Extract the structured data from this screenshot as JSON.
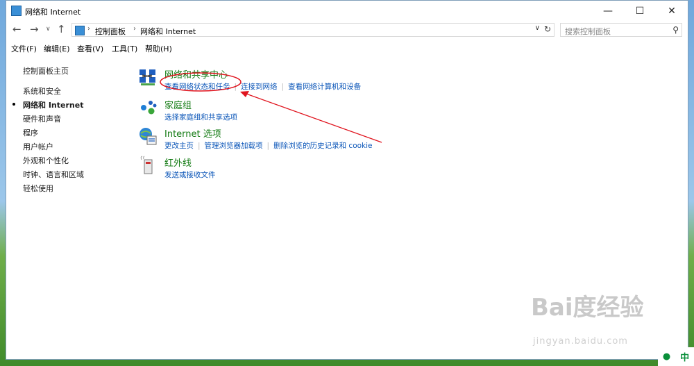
{
  "window": {
    "title": "网络和 Internet"
  },
  "address": {
    "breadcrumbs": [
      "控制面板",
      "网络和 Internet"
    ],
    "search_placeholder": "搜索控制面板"
  },
  "menu": [
    "文件(F)",
    "编辑(E)",
    "查看(V)",
    "工具(T)",
    "帮助(H)"
  ],
  "sidebar": {
    "items": [
      {
        "label": "控制面板主页",
        "active": false
      },
      {
        "label": "系统和安全",
        "active": false
      },
      {
        "label": "网络和 Internet",
        "active": true
      },
      {
        "label": "硬件和声音",
        "active": false
      },
      {
        "label": "程序",
        "active": false
      },
      {
        "label": "用户帐户",
        "active": false
      },
      {
        "label": "外观和个性化",
        "active": false
      },
      {
        "label": "时钟、语言和区域",
        "active": false
      },
      {
        "label": "轻松使用",
        "active": false
      }
    ]
  },
  "categories": [
    {
      "icon": "network-sharing-center-icon",
      "title": "网络和共享中心",
      "links": [
        "查看网络状态和任务",
        "连接到网络",
        "查看网络计算机和设备"
      ]
    },
    {
      "icon": "homegroup-icon",
      "title": "家庭组",
      "links": [
        "选择家庭组和共享选项"
      ]
    },
    {
      "icon": "internet-options-icon",
      "title": "Internet 选项",
      "links": [
        "更改主页",
        "管理浏览器加载项",
        "删除浏览的历史记录和 cookie"
      ]
    },
    {
      "icon": "infrared-icon",
      "title": "红外线",
      "links": [
        "发送或接收文件"
      ]
    }
  ],
  "overlay": {
    "watermark": "Bai度经验",
    "watermark_sub": "jingyan.baidu.com",
    "ime_lang": "中"
  },
  "colors": {
    "category_title": "#127a12",
    "link": "#0a55b8",
    "annotation": "#e0141e"
  }
}
